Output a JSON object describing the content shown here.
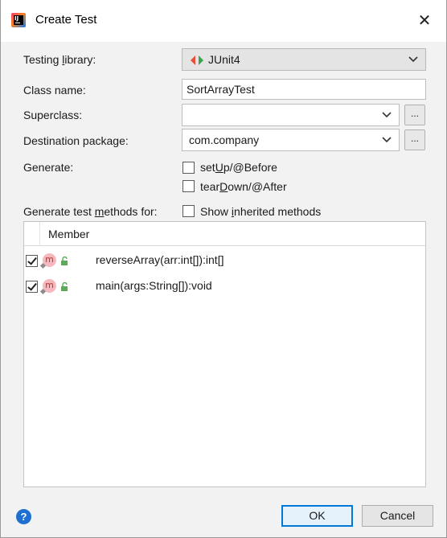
{
  "window": {
    "title": "Create Test",
    "app_icon_text": "IJ"
  },
  "form": {
    "testing_library": {
      "label_pre": "Testing ",
      "label_u": "l",
      "label_post": "ibrary:",
      "value": "JUnit4"
    },
    "class_name": {
      "label": "Class name:",
      "value": "SortArrayTest"
    },
    "superclass": {
      "label": "Superclass:",
      "value": "",
      "browse_label": "..."
    },
    "destination_package": {
      "label": "Destination package:",
      "value": "com.company",
      "browse_label": "..."
    },
    "generate": {
      "label": "Generate:",
      "options": [
        {
          "label_pre": "set",
          "label_u": "U",
          "label_post": "p/@Before",
          "checked": false
        },
        {
          "label_pre": "tear",
          "label_u": "D",
          "label_post": "own/@After",
          "checked": false
        }
      ]
    },
    "generate_methods": {
      "label_pre": "Generate test ",
      "label_u": "m",
      "label_post": "ethods for:",
      "show_inherited": {
        "label_pre": "Show ",
        "label_u": "i",
        "label_post": "nherited methods",
        "checked": false
      }
    }
  },
  "members_table": {
    "column_header": "Member",
    "rows": [
      {
        "checked": true,
        "icon_letter": "m",
        "method": "reverseArray(arr:int[]):int[]"
      },
      {
        "checked": true,
        "icon_letter": "m",
        "method": "main(args:String[]):void"
      }
    ]
  },
  "footer": {
    "help_icon_text": "?",
    "ok_label": "OK",
    "cancel_label": "Cancel"
  },
  "colors": {
    "junit_red": "#e8503a",
    "junit_green": "#3fa34d",
    "accent": "#0078d7",
    "method_icon_bg": "#f5b9bd",
    "lock_green": "#5fa85a"
  }
}
